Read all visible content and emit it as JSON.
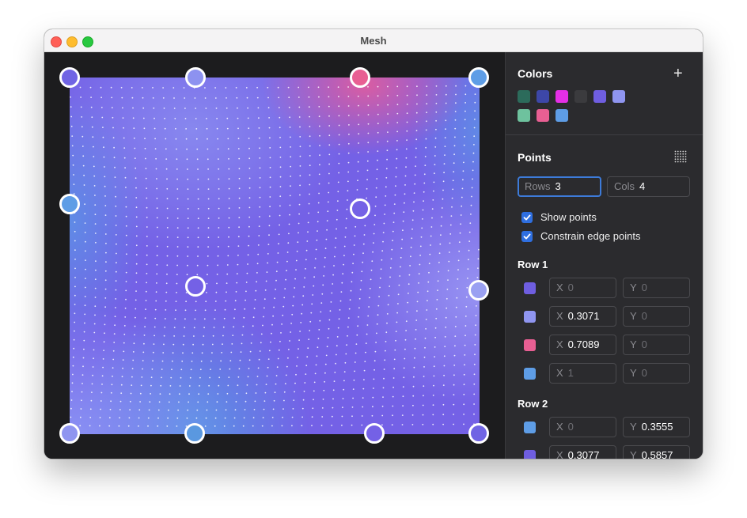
{
  "window": {
    "title": "Mesh"
  },
  "mesh_handles": [
    {
      "id": "r1c1",
      "color": "#7064e4"
    },
    {
      "id": "r1c2",
      "color": "#8d92f0"
    },
    {
      "id": "r1c3",
      "color": "#e85f93"
    },
    {
      "id": "r1c4",
      "color": "#5e9de6"
    },
    {
      "id": "r2c1",
      "color": "#5e9de6"
    },
    {
      "id": "r2c2",
      "color": "#7461e6"
    },
    {
      "id": "r2c3",
      "color": "#7461e6"
    },
    {
      "id": "r2c4",
      "color": "#9aa0f2"
    },
    {
      "id": "r3c1",
      "color": "#8f95f0"
    },
    {
      "id": "r3c2",
      "color": "#5a98e0"
    },
    {
      "id": "r3c3",
      "color": "#7461e6"
    },
    {
      "id": "r3c4",
      "color": "#7064e4"
    }
  ],
  "colors_section": {
    "title": "Colors",
    "add_icon": "plus-icon",
    "swatches": [
      "#2c6b5b",
      "#3d47a8",
      "#e52fe6",
      "#3b3b3e",
      "#6f5ee0",
      "#8f95f0",
      "#6ec29e",
      "#e85f93",
      "#5e9de6"
    ]
  },
  "points_section": {
    "title": "Points",
    "grid_icon": "dot-grid-icon",
    "rows_label": "Rows",
    "rows_value": "3",
    "cols_label": "Cols",
    "cols_value": "4",
    "show_points_label": "Show points",
    "show_points_checked": true,
    "constrain_label": "Constrain edge points",
    "constrain_checked": true
  },
  "row1": {
    "title": "Row 1",
    "points": [
      {
        "color": "#6f5ee0",
        "x_label": "X",
        "x_value": "",
        "x_placeholder": "0",
        "y_label": "Y",
        "y_value": "",
        "y_placeholder": "0"
      },
      {
        "color": "#8f95f0",
        "x_label": "X",
        "x_value": "0.3071",
        "x_placeholder": "",
        "y_label": "Y",
        "y_value": "",
        "y_placeholder": "0"
      },
      {
        "color": "#e85f93",
        "x_label": "X",
        "x_value": "0.7089",
        "x_placeholder": "",
        "y_label": "Y",
        "y_value": "",
        "y_placeholder": "0"
      },
      {
        "color": "#5e9de6",
        "x_label": "X",
        "x_value": "",
        "x_placeholder": "1",
        "y_label": "Y",
        "y_value": "",
        "y_placeholder": "0"
      }
    ]
  },
  "row2": {
    "title": "Row 2",
    "points": [
      {
        "color": "#5e9de6",
        "x_label": "X",
        "x_value": "",
        "x_placeholder": "0",
        "y_label": "Y",
        "y_value": "0.3555",
        "y_placeholder": ""
      },
      {
        "color": "#6f5ee0",
        "x_label": "X",
        "x_value": "0.3077",
        "x_placeholder": "",
        "y_label": "Y",
        "y_value": "0.5857",
        "y_placeholder": ""
      }
    ]
  }
}
